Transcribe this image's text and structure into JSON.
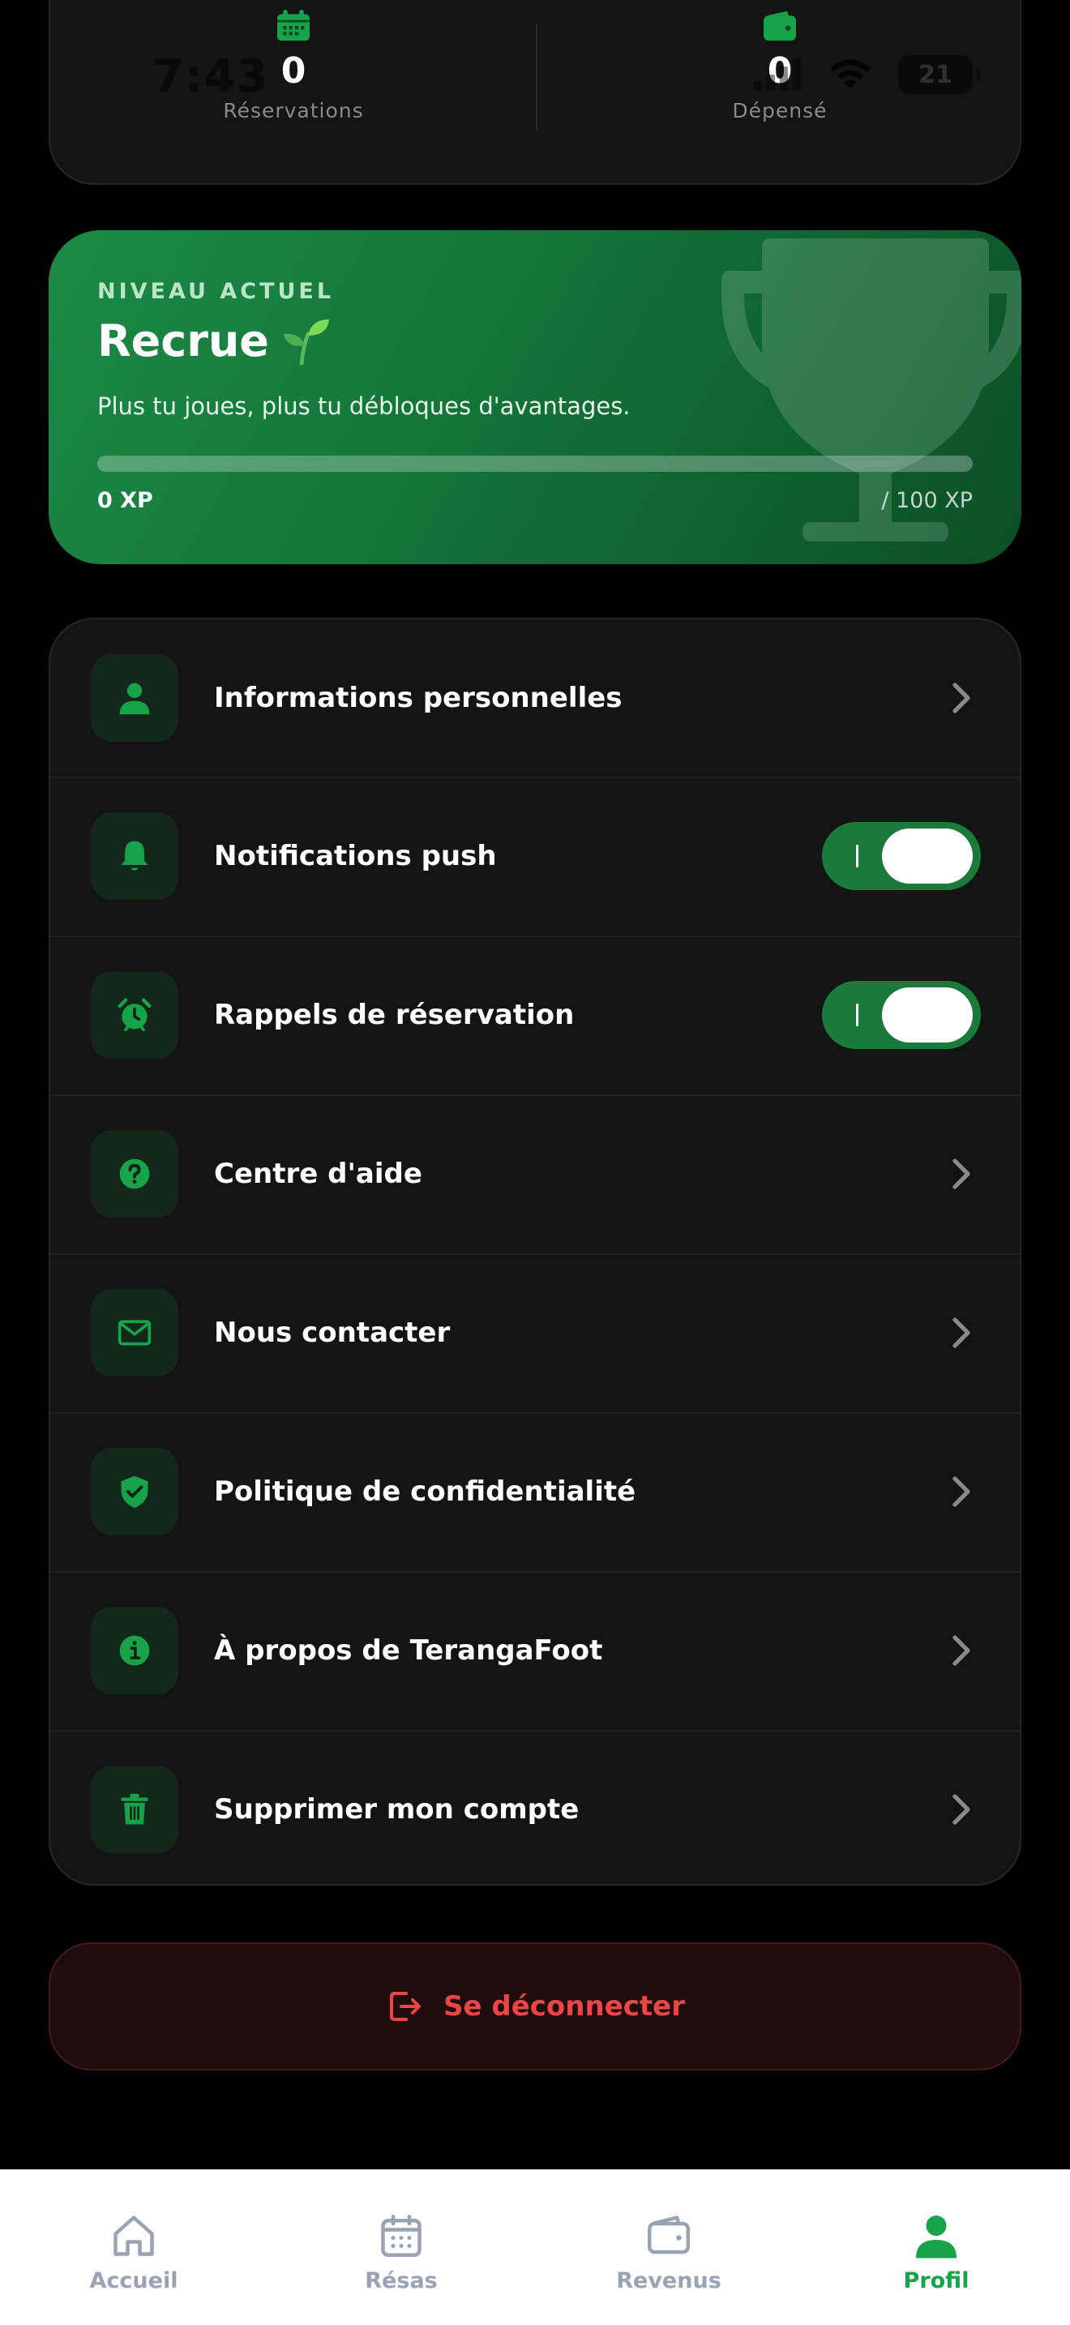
{
  "status_bar": {
    "time": "7:43",
    "battery": "21"
  },
  "stats": {
    "reservations": {
      "value": "0",
      "label": "Réservations",
      "icon": "calendar-icon"
    },
    "spent": {
      "value": "0",
      "label": "Dépensé",
      "icon": "wallet-icon"
    }
  },
  "level": {
    "eyebrow": "NIVEAU ACTUEL",
    "title": "Recrue",
    "subtitle": "Plus tu joues, plus tu débloques d'avantages.",
    "xp_current": "0 XP",
    "xp_max": "/ 100 XP",
    "xp_progress": 0
  },
  "settings": {
    "items": [
      {
        "label": "Informations personnelles",
        "icon": "user-icon",
        "type": "link"
      },
      {
        "label": "Notifications push",
        "icon": "bell-icon",
        "type": "toggle",
        "enabled": true
      },
      {
        "label": "Rappels de réservation",
        "icon": "alarm-clock-icon",
        "type": "toggle",
        "enabled": true
      },
      {
        "label": "Centre d'aide",
        "icon": "help-circle-icon",
        "type": "link"
      },
      {
        "label": "Nous contacter",
        "icon": "mail-icon",
        "type": "link"
      },
      {
        "label": "Politique de confidentialité",
        "icon": "shield-check-icon",
        "type": "link"
      },
      {
        "label": "À propos de TerangaFoot",
        "icon": "info-icon",
        "type": "link"
      },
      {
        "label": "Supprimer mon compte",
        "icon": "trash-icon",
        "type": "link"
      }
    ]
  },
  "logout": {
    "label": "Se déconnecter",
    "icon": "logout-icon"
  },
  "tabbar": {
    "tabs": [
      {
        "label": "Accueil",
        "icon": "home-icon",
        "active": false
      },
      {
        "label": "Résas",
        "icon": "calendar-icon",
        "active": false
      },
      {
        "label": "Revenus",
        "icon": "wallet-icon",
        "active": false
      },
      {
        "label": "Profil",
        "icon": "user-icon",
        "active": true
      }
    ]
  },
  "colors": {
    "accent": "#16a34a",
    "level_gradient_start": "#1c8a46",
    "level_gradient_end": "#0b4f27",
    "danger": "#ef4444",
    "surface": "#141414",
    "background": "#000000"
  }
}
